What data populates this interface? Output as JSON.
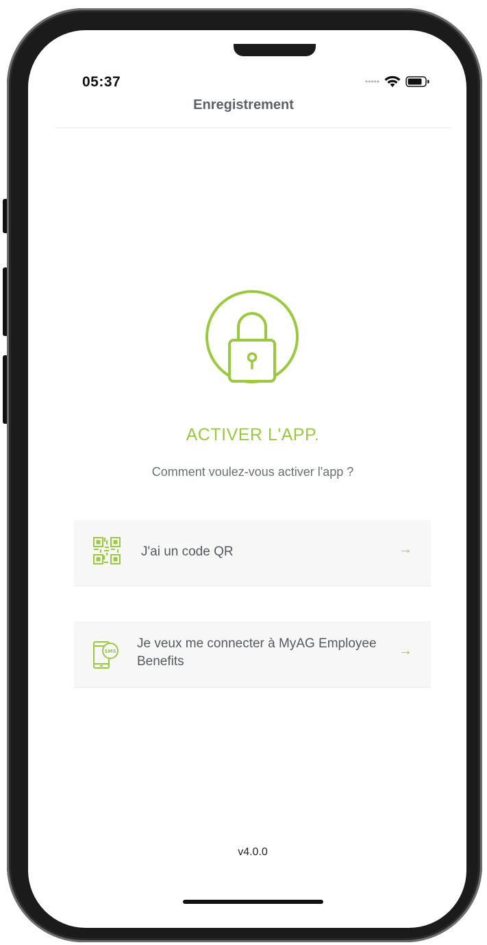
{
  "status_bar": {
    "time": "05:37",
    "signal_icon": "signal-dots-icon",
    "wifi_icon": "wifi-icon",
    "battery_icon": "battery-icon"
  },
  "header": {
    "title": "Enregistrement"
  },
  "hero": {
    "icon": "lock-icon",
    "title": "ACTIVER L'APP.",
    "subtitle": "Comment voulez-vous activer l'app ?"
  },
  "options": [
    {
      "icon": "qr-code-icon",
      "label": "J'ai un code QR",
      "arrow": "→"
    },
    {
      "icon": "sms-phone-icon",
      "label": "Je veux me connecter à MyAG Employee Benefits",
      "arrow": "→"
    }
  ],
  "footer": {
    "version": "v4.0.0"
  },
  "colors": {
    "accent": "#9ac93e",
    "text_muted": "#6a6d72",
    "card_background": "#f7f7f7"
  }
}
